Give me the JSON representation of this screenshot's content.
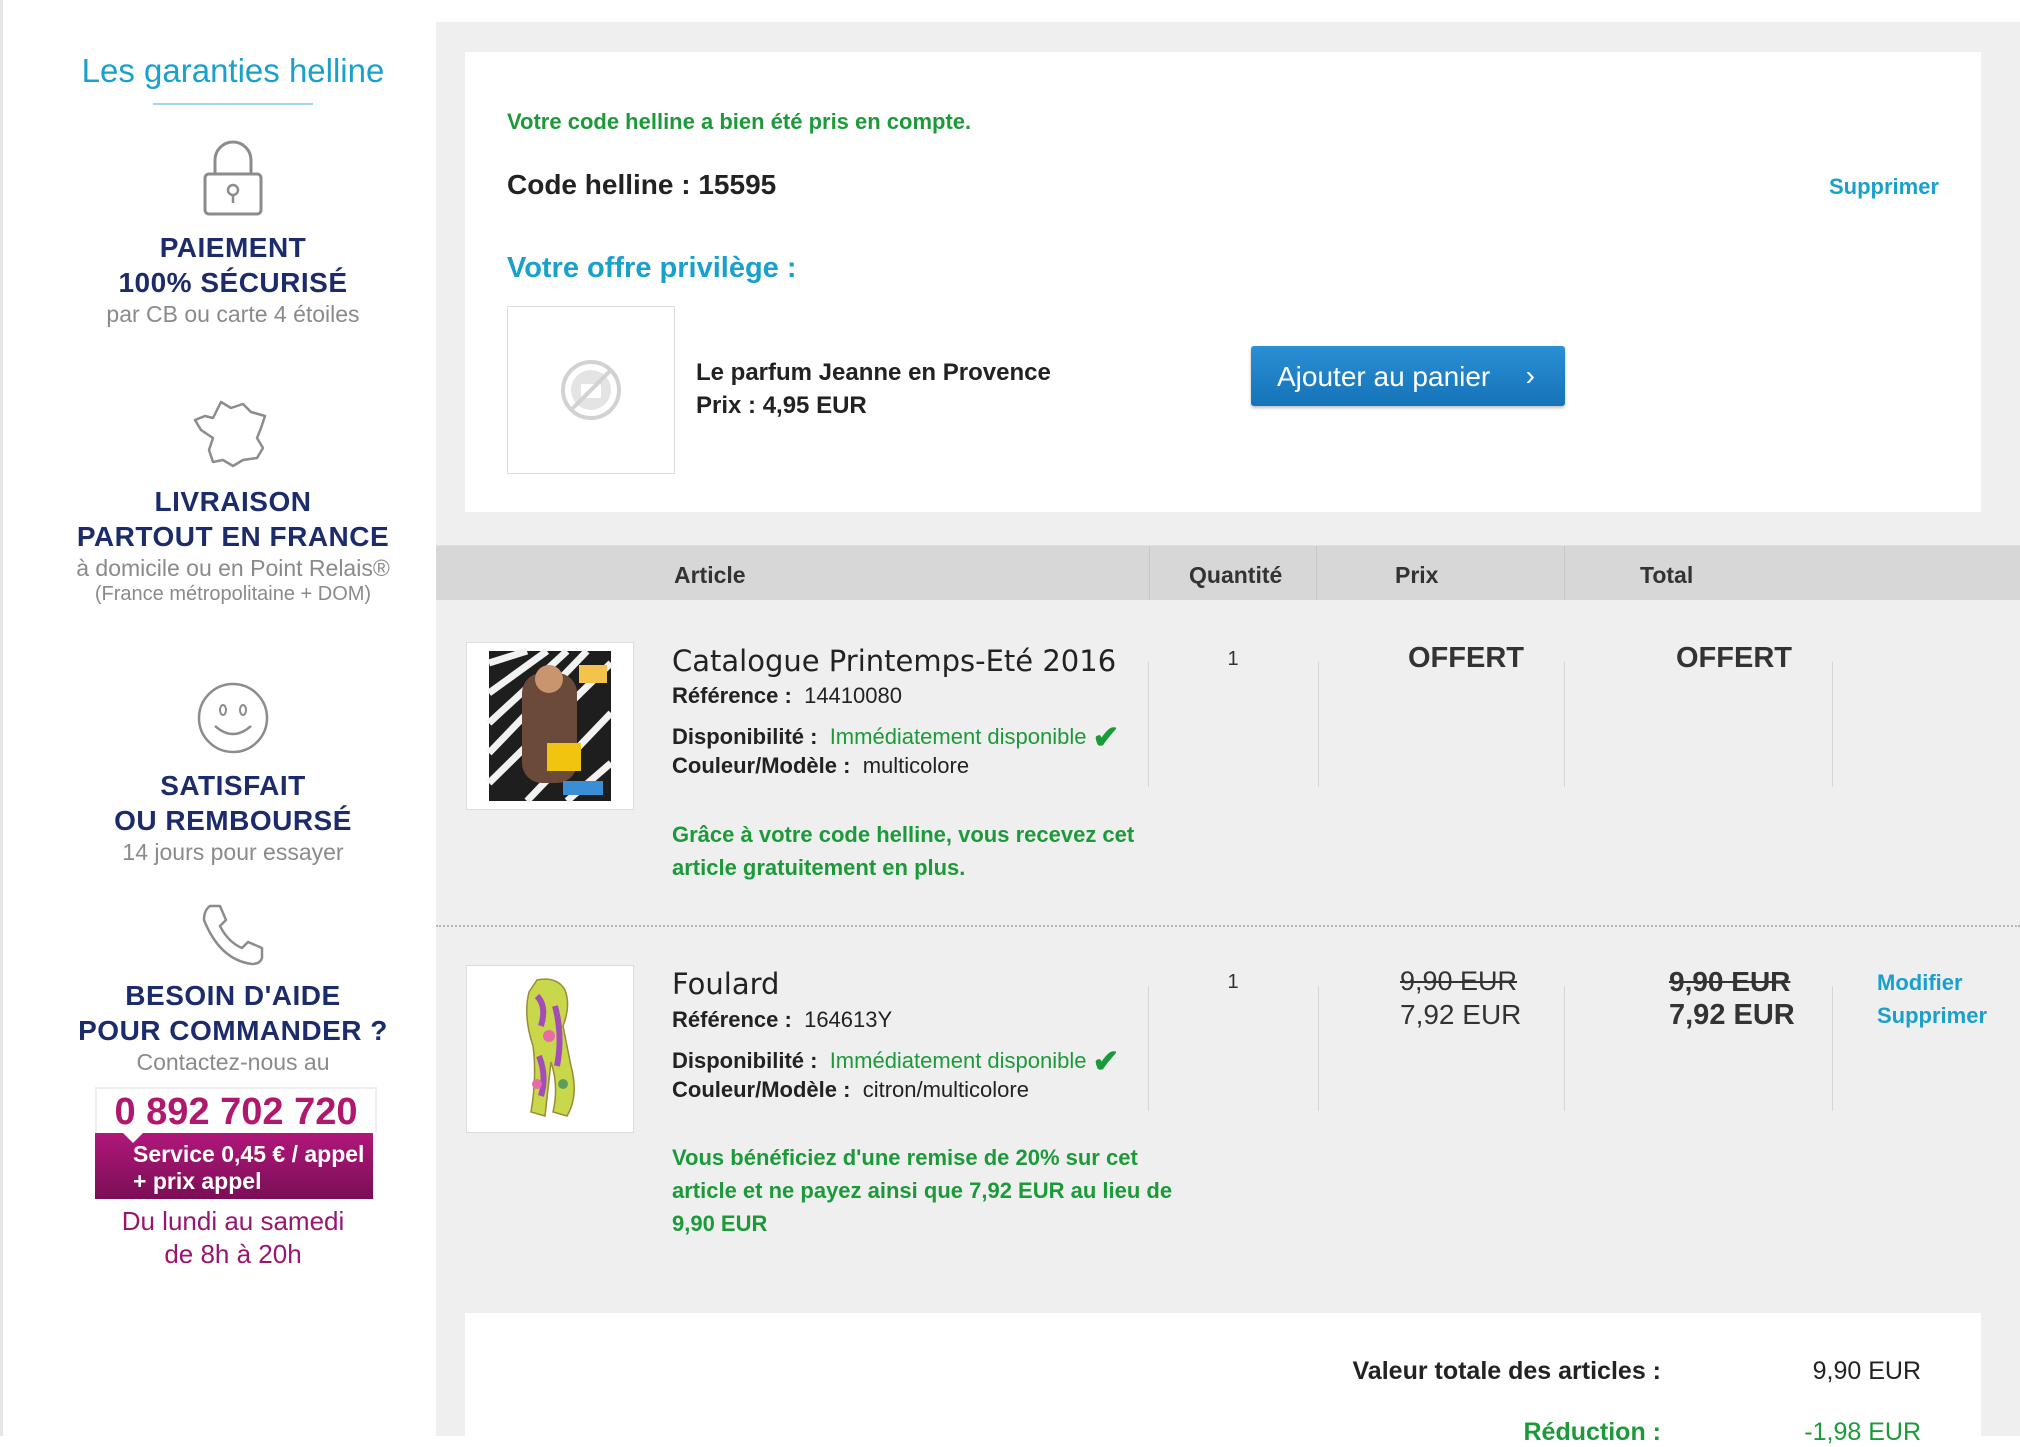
{
  "guarantees": {
    "title": "Les garanties helline",
    "payment": {
      "head1": "PAIEMENT",
      "head2": "100% SÉCURISÉ",
      "sub": "par CB ou carte 4 étoiles"
    },
    "delivery": {
      "head1": "LIVRAISON",
      "head2": "PARTOUT EN FRANCE",
      "sub": "à domicile ou en  Point Relais®",
      "sub2": "(France métropolitaine + DOM)"
    },
    "satisfaction": {
      "head1": "SATISFAIT",
      "head2": "OU REMBOURSÉ",
      "sub": "14 jours pour essayer"
    },
    "help": {
      "head1": "BESOIN D'AIDE",
      "head2": "POUR COMMANDER ?",
      "sub": "Contactez-nous au",
      "phone": "0 892 702 720",
      "service1": "Service 0,45 € / appel",
      "service2": "+ prix appel",
      "hours1": "Du lundi au samedi",
      "hours2": "de 8h à 20h"
    }
  },
  "promo": {
    "confirmation": "Votre code helline a bien été pris en compte.",
    "code": "Code helline : 15595",
    "remove_label": "Supprimer",
    "offer_title": "Votre offre privilège :",
    "offer_name": "Le parfum Jeanne en Provence",
    "offer_price": "Prix : 4,95 EUR",
    "add_button": "Ajouter au panier"
  },
  "table": {
    "headers": {
      "article": "Article",
      "quantity": "Quantité",
      "price": "Prix",
      "total": "Total"
    }
  },
  "items": [
    {
      "name": "Catalogue Printemps-Eté 2016",
      "ref_label": "Référence :",
      "ref": "14410080",
      "avail_label": "Disponibilité :",
      "avail": "Immédiatement disponible",
      "color_label": "Couleur/Modèle :",
      "color": "multicolore",
      "note": "Grâce à votre code helline, vous recevez cet article gratuitement en plus.",
      "qty": "1",
      "price": "OFFERT",
      "total": "OFFERT"
    },
    {
      "name": "Foulard",
      "ref_label": "Référence :",
      "ref": "164613Y",
      "avail_label": "Disponibilité :",
      "avail": "Immédiatement disponible",
      "color_label": "Couleur/Modèle :",
      "color": "citron/multicolore",
      "note": "Vous bénéficiez d'une remise de 20% sur cet article et ne payez ainsi que 7,92 EUR au lieu de 9,90 EUR",
      "qty": "1",
      "price_old": "9,90 EUR",
      "price_new": "7,92 EUR",
      "total_old": "9,90 EUR",
      "total_new": "7,92 EUR",
      "modify_label": "Modifier",
      "remove_label": "Supprimer"
    }
  ],
  "summary": {
    "total_label": "Valeur totale des articles :",
    "total_value": "9,90 EUR",
    "discount_label": "Réduction :",
    "discount_value": "-1,98 EUR"
  },
  "colors": {
    "accent": "#1aa0cc",
    "green": "#1c9a3a",
    "navy": "#1b2b6b",
    "magenta": "#b0176e",
    "button": "#1e80c6"
  }
}
